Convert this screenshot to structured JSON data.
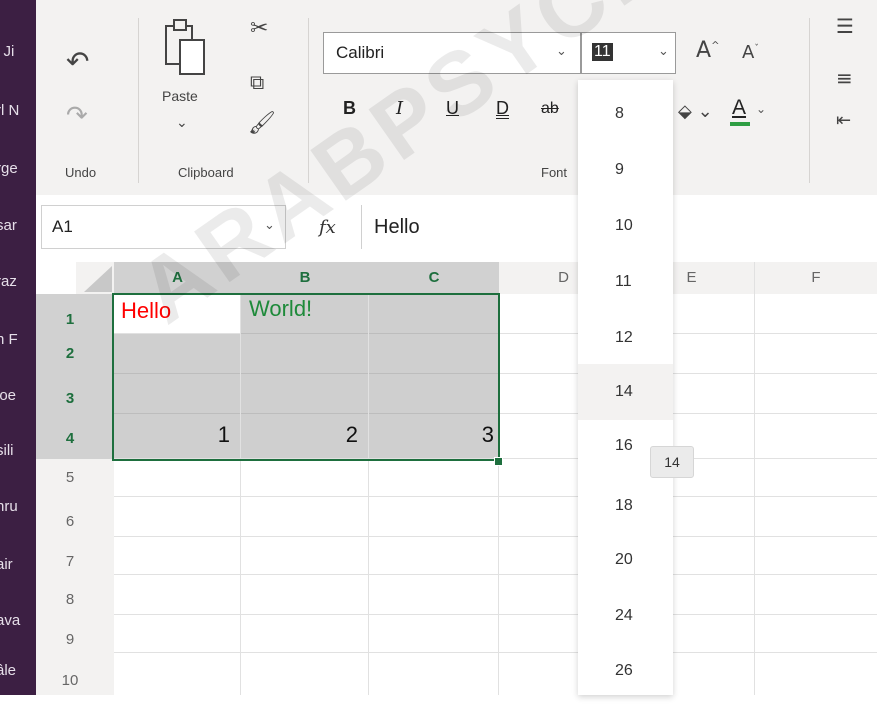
{
  "left_panel": {
    "items": [
      "i Ji",
      "rl N",
      "rge",
      "sar",
      "raz",
      "n F",
      "loe",
      "sili",
      "hru",
      "air",
      "ava",
      "âle"
    ]
  },
  "ribbon": {
    "undo_label": "Undo",
    "clipboard_label": "Clipboard",
    "paste_label": "Paste",
    "font_group_label": "Font",
    "font_name": "Calibri",
    "font_size": "11",
    "bold_label": "B",
    "italic_label": "I",
    "underline_label": "U",
    "double_underline_label": "D",
    "strike_label": "ab",
    "grow_font_label": "A",
    "shrink_font_label": "A",
    "font_color_label": "A",
    "font_color": "#2e9e43"
  },
  "formula_bar": {
    "name_box": "A1",
    "fx_label": "fx",
    "content": "Hello"
  },
  "columns": [
    "A",
    "B",
    "C",
    "D",
    "E",
    "F"
  ],
  "rows": [
    "1",
    "2",
    "3",
    "4",
    "5",
    "6",
    "7",
    "8",
    "9",
    "10"
  ],
  "cells": {
    "A1": "Hello",
    "B1": "World!",
    "A4": "1",
    "B4": "2",
    "C4": "3"
  },
  "colors": {
    "A1": "#ff0000",
    "B1": "#1e8a3a",
    "selection_border": "#1e6f3e",
    "ribbon_bg": "#f3f2f1",
    "panel_bg": "#3c1f43"
  },
  "font_size_dropdown": {
    "options": [
      "8",
      "9",
      "10",
      "11",
      "12",
      "14",
      "16",
      "18",
      "20",
      "24",
      "26"
    ],
    "highlighted": "14"
  },
  "tooltip": "14",
  "watermark": "ARABPSYCH"
}
